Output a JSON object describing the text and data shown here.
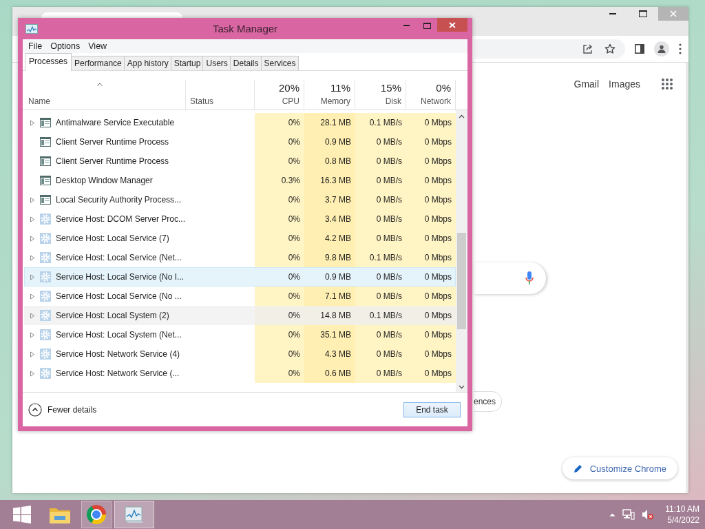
{
  "browser": {
    "top_links": [
      "Gmail",
      "Images"
    ],
    "chip": "ences",
    "customize_button": "Customize Chrome"
  },
  "task_manager": {
    "title": "Task Manager",
    "menu": [
      "File",
      "Options",
      "View"
    ],
    "tabs": [
      {
        "label": "Processes",
        "selected": true
      },
      {
        "label": "Performance",
        "selected": false
      },
      {
        "label": "App history",
        "selected": false
      },
      {
        "label": "Startup",
        "selected": false
      },
      {
        "label": "Users",
        "selected": false
      },
      {
        "label": "Details",
        "selected": false
      },
      {
        "label": "Services",
        "selected": false
      }
    ],
    "columns": [
      {
        "label": "Name"
      },
      {
        "label": "Status"
      },
      {
        "percent": "20%",
        "label": "CPU"
      },
      {
        "percent": "11%",
        "label": "Memory"
      },
      {
        "percent": "15%",
        "label": "Disk"
      },
      {
        "percent": "0%",
        "label": "Network"
      }
    ],
    "rows": [
      {
        "name": "Antimalware Service Executable",
        "kind": "app",
        "expandable": true,
        "selected": false,
        "hovered": false,
        "cpu": "0%",
        "memory": "28.1 MB",
        "disk": "0.1 MB/s",
        "network": "0 Mbps"
      },
      {
        "name": "Client Server Runtime Process",
        "kind": "app",
        "expandable": false,
        "selected": false,
        "hovered": false,
        "cpu": "0%",
        "memory": "0.9 MB",
        "disk": "0 MB/s",
        "network": "0 Mbps"
      },
      {
        "name": "Client Server Runtime Process",
        "kind": "app",
        "expandable": false,
        "selected": false,
        "hovered": false,
        "cpu": "0%",
        "memory": "0.8 MB",
        "disk": "0 MB/s",
        "network": "0 Mbps"
      },
      {
        "name": "Desktop Window Manager",
        "kind": "app",
        "expandable": false,
        "selected": false,
        "hovered": false,
        "cpu": "0.3%",
        "memory": "16.3 MB",
        "disk": "0 MB/s",
        "network": "0 Mbps"
      },
      {
        "name": "Local Security Authority Process...",
        "kind": "app",
        "expandable": true,
        "selected": false,
        "hovered": false,
        "cpu": "0%",
        "memory": "3.7 MB",
        "disk": "0 MB/s",
        "network": "0 Mbps"
      },
      {
        "name": "Service Host: DCOM Server Proc...",
        "kind": "service",
        "expandable": true,
        "selected": false,
        "hovered": false,
        "cpu": "0%",
        "memory": "3.4 MB",
        "disk": "0 MB/s",
        "network": "0 Mbps"
      },
      {
        "name": "Service Host: Local Service (7)",
        "kind": "service",
        "expandable": true,
        "selected": false,
        "hovered": false,
        "cpu": "0%",
        "memory": "4.2 MB",
        "disk": "0 MB/s",
        "network": "0 Mbps"
      },
      {
        "name": "Service Host: Local Service (Net...",
        "kind": "service",
        "expandable": true,
        "selected": false,
        "hovered": false,
        "cpu": "0%",
        "memory": "9.8 MB",
        "disk": "0.1 MB/s",
        "network": "0 Mbps"
      },
      {
        "name": "Service Host: Local Service (No I...",
        "kind": "service",
        "expandable": true,
        "selected": true,
        "hovered": false,
        "cpu": "0%",
        "memory": "0.9 MB",
        "disk": "0 MB/s",
        "network": "0 Mbps"
      },
      {
        "name": "Service Host: Local Service (No ...",
        "kind": "service",
        "expandable": true,
        "selected": false,
        "hovered": false,
        "cpu": "0%",
        "memory": "7.1 MB",
        "disk": "0 MB/s",
        "network": "0 Mbps"
      },
      {
        "name": "Service Host: Local System (2)",
        "kind": "service",
        "expandable": true,
        "selected": false,
        "hovered": true,
        "cpu": "0%",
        "memory": "14.8 MB",
        "disk": "0.1 MB/s",
        "network": "0 Mbps"
      },
      {
        "name": "Service Host: Local System (Net...",
        "kind": "service",
        "expandable": true,
        "selected": false,
        "hovered": false,
        "cpu": "0%",
        "memory": "35.1 MB",
        "disk": "0 MB/s",
        "network": "0 Mbps"
      },
      {
        "name": "Service Host: Network Service (4)",
        "kind": "service",
        "expandable": true,
        "selected": false,
        "hovered": false,
        "cpu": "0%",
        "memory": "4.3 MB",
        "disk": "0 MB/s",
        "network": "0 Mbps"
      },
      {
        "name": "Service Host: Network Service (...",
        "kind": "service",
        "expandable": true,
        "selected": false,
        "hovered": false,
        "cpu": "0%",
        "memory": "0.6 MB",
        "disk": "0 MB/s",
        "network": "0 Mbps"
      }
    ],
    "footer": {
      "fewer_details": "Fewer details",
      "end_task": "End task"
    }
  },
  "taskbar": {
    "time": "11:10 AM",
    "date": "5/4/2022"
  }
}
